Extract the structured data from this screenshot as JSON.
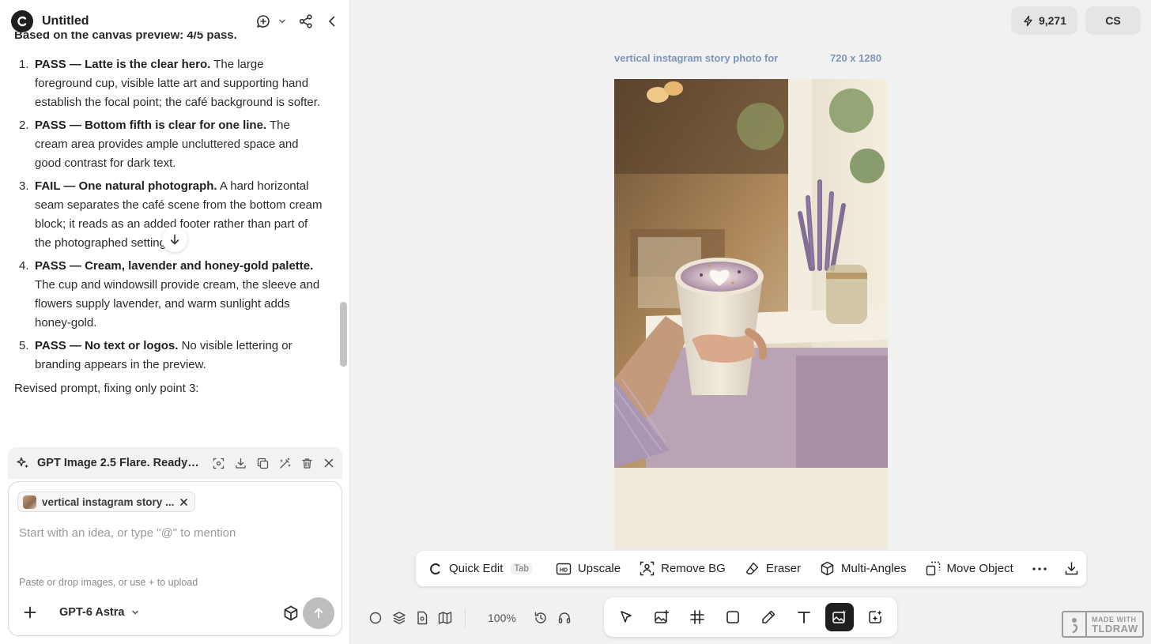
{
  "app": {
    "title": "Untitled"
  },
  "chat": {
    "cutoff_text": "Based on the canvas preview: 4/5 pass.",
    "items": [
      {
        "num": "1.",
        "bold": "PASS — Latte is the clear hero.",
        "text": " The large foreground cup, visible latte art and supporting hand establish the focal point; the café background is softer."
      },
      {
        "num": "2.",
        "bold": "PASS — Bottom fifth is clear for one line.",
        "text": " The cream area provides ample uncluttered space and good contrast for dark text."
      },
      {
        "num": "3.",
        "bold": "FAIL — One natural photograph.",
        "text": " A hard horizontal seam separates the café scene from the bottom cream block; it reads as an added footer rather than part of the photographed setting."
      },
      {
        "num": "4.",
        "bold": "PASS — Cream, lavender and honey-gold palette.",
        "text": " The cup and windowsill provide cream, the sleeve and flowers supply lavender, and warm sunlight adds honey-gold."
      },
      {
        "num": "5.",
        "bold": "PASS — No text or logos.",
        "text": " No visible lettering or branding appears in the preview."
      }
    ],
    "revised": "Revised prompt, fixing only point 3:"
  },
  "generation": {
    "status": "GPT Image 2.5 Flare. Ready ..."
  },
  "composer": {
    "chip_label": "vertical instagram story ...",
    "placeholder": "Start with an idea, or type \"@\" to mention",
    "hint": "Paste or drop images, or use + to upload",
    "model": "GPT-6 Astra"
  },
  "header": {
    "credits": "9,271",
    "user_initials": "CS"
  },
  "canvas": {
    "frame_label": "vertical instagram story photo for",
    "frame_size": "720 x 1280",
    "zoom": "100%"
  },
  "toolbar": {
    "quick_edit": "Quick Edit",
    "quick_edit_key": "Tab",
    "upscale": "Upscale",
    "remove_bg": "Remove BG",
    "eraser": "Eraser",
    "multi_angles": "Multi-Angles",
    "move_object": "Move Object"
  },
  "watermark": {
    "line1": "MADE WITH",
    "line2": "TLDRAW"
  },
  "colors": {
    "accent_dark": "#1f1f1f",
    "frame_label": "#7d95b8",
    "canvas_bg": "#f1f1f1"
  }
}
